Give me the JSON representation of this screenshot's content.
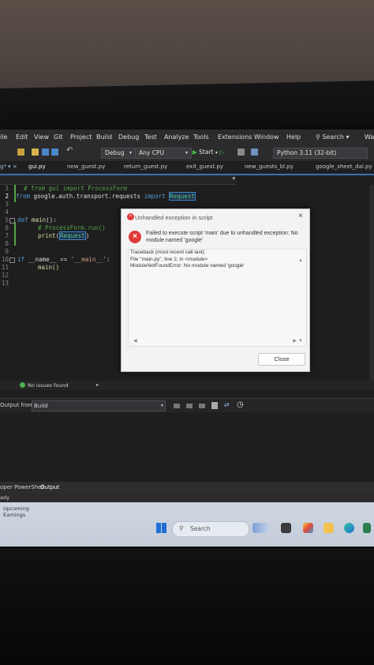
{
  "menu": [
    "ile",
    "Edit",
    "View",
    "Git",
    "Project",
    "Build",
    "Debug",
    "Test",
    "Analyze",
    "Tools",
    "Extensions",
    "Window",
    "Help"
  ],
  "search_label": "Search",
  "menu_overflow": "Wa",
  "toolbar": {
    "config": "Debug",
    "platform": "Any CPU",
    "start_label": "Start",
    "python_env": "Python 3.11 (32-bit)"
  },
  "tabs": [
    "gui.py",
    "new_guest.py",
    "return_guest.py",
    "exit_guest.py",
    "new_guests_bl.py",
    "google_sheet_dal.py"
  ],
  "editor": {
    "line_numbers": [
      "1",
      "2",
      "3",
      "4",
      "5",
      "6",
      "7",
      "8",
      "9",
      "10",
      "11",
      "12",
      "13"
    ],
    "lines": {
      "l1": "# from gui import ProcessForm",
      "l2_kw1": "from",
      "l2_mod": " google.auth.transport.requests ",
      "l2_kw2": "import",
      "l2_sp": " ",
      "l2_name": "Request",
      "l5_kw": "def",
      "l5_fn": " main",
      "l5_rest": "():",
      "l6": "# ProcessForm.run()",
      "l7_fn": "print",
      "l7_open": "(",
      "l7_arg": "Request",
      "l7_close": ")",
      "l10_kw": "if",
      "l10_mid": " __name__ == ",
      "l10_str": "'__main__'",
      "l10_end": ":",
      "l11": "main()"
    }
  },
  "dialog": {
    "title": "Unhandled exception in script",
    "message": "Failed to execute script 'main' due to unhandled exception: No module named 'google'",
    "traceback": [
      "Traceback (most recent call last):",
      "  File \"main.py\", line 2, in <module>",
      "ModuleNotFoundError: No module named 'google'"
    ],
    "close_label": "Close"
  },
  "issues_text": "No issues found",
  "output": {
    "label": "Output from:",
    "source": "Build"
  },
  "panel_tabs": [
    "oper PowerShell",
    "Output"
  ],
  "status_text": "ady",
  "taskbar": {
    "weather_title": "Upcoming",
    "weather_sub": "Earnings",
    "search_placeholder": "Search"
  },
  "colors": {
    "editor_bg": "#1e1e1e",
    "keyword": "#569cd6",
    "comment": "#57a64a",
    "error_red": "#e13a3a",
    "accent": "#3f6fb0"
  }
}
